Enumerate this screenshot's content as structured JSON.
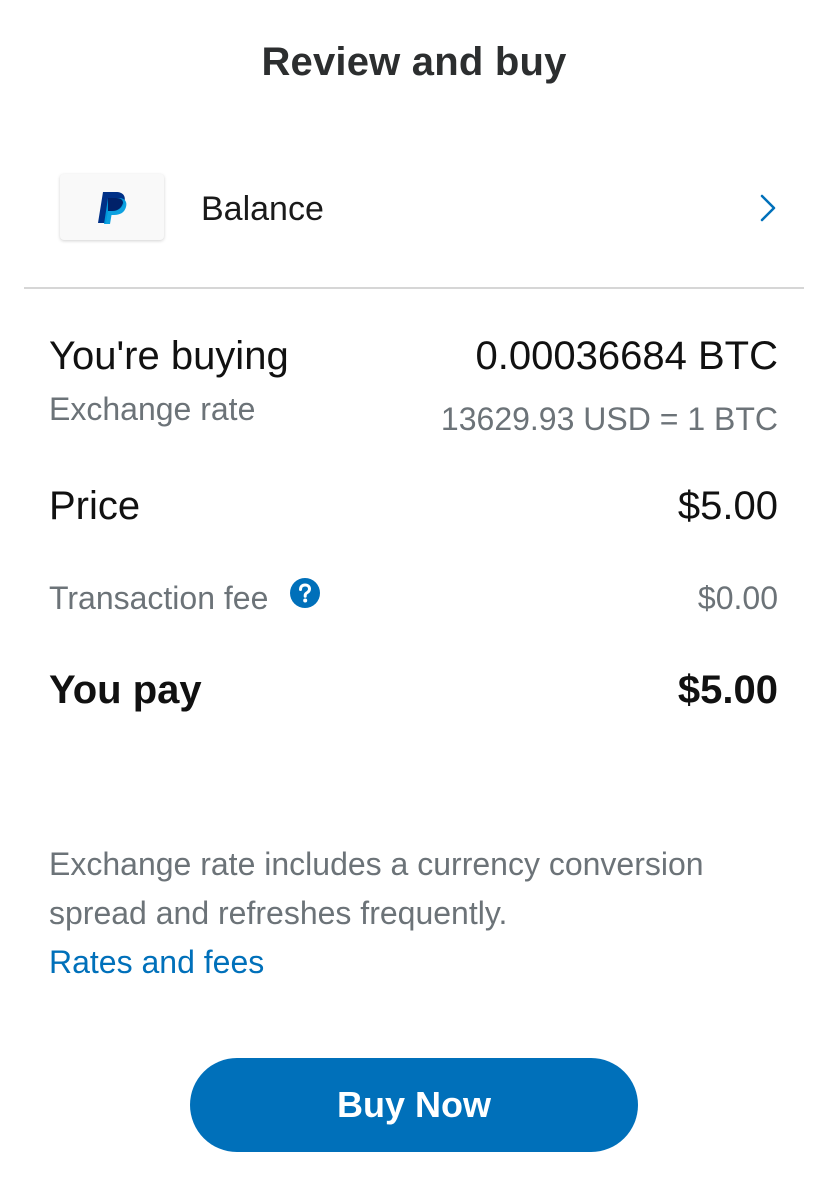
{
  "header": {
    "title": "Review and buy"
  },
  "funding_source": {
    "label": "Balance",
    "logo_icon": "paypal-logo-icon",
    "chevron_icon": "chevron-right-icon"
  },
  "summary": {
    "buying_label": "You're buying",
    "buying_value": "0.00036684 BTC",
    "exchange_rate_label": "Exchange rate",
    "exchange_rate_value": "13629.93 USD = 1 BTC",
    "price_label": "Price",
    "price_value": "$5.00",
    "fee_label": "Transaction fee",
    "fee_help_icon": "question-circle-icon",
    "fee_value": "$0.00",
    "total_label": "You pay",
    "total_value": "$5.00"
  },
  "disclaimer": {
    "text": "Exchange rate includes a currency conversion spread and refreshes frequently.",
    "link_label": "Rates and fees"
  },
  "actions": {
    "buy_label": "Buy Now"
  },
  "colors": {
    "accent": "#0070ba",
    "muted_text": "#6c7378",
    "divider": "#d6d6d6",
    "paypal_dark_blue": "#003087",
    "paypal_light_blue": "#009cde"
  }
}
